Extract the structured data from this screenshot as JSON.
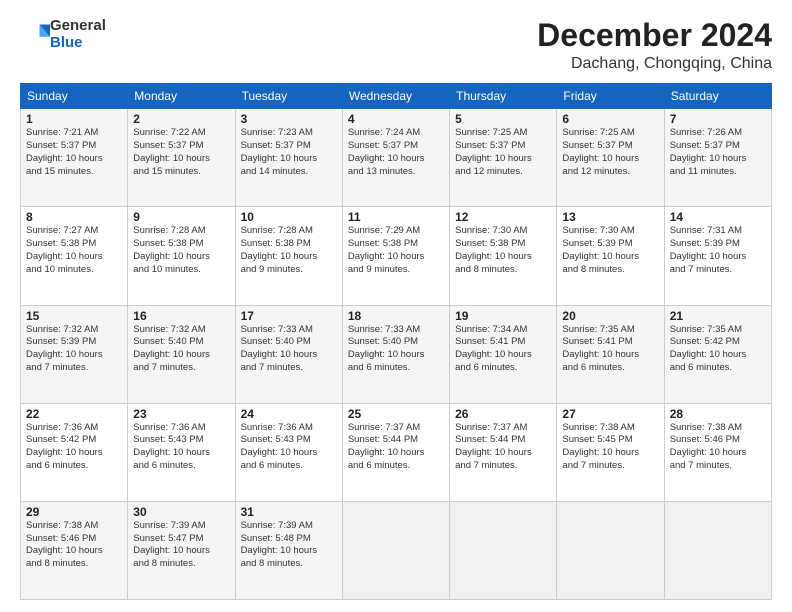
{
  "header": {
    "logo_line1": "General",
    "logo_line2": "Blue",
    "month": "December 2024",
    "location": "Dachang, Chongqing, China"
  },
  "weekdays": [
    "Sunday",
    "Monday",
    "Tuesday",
    "Wednesday",
    "Thursday",
    "Friday",
    "Saturday"
  ],
  "weeks": [
    [
      {
        "day": "1",
        "info": "Sunrise: 7:21 AM\nSunset: 5:37 PM\nDaylight: 10 hours\nand 15 minutes."
      },
      {
        "day": "2",
        "info": "Sunrise: 7:22 AM\nSunset: 5:37 PM\nDaylight: 10 hours\nand 15 minutes."
      },
      {
        "day": "3",
        "info": "Sunrise: 7:23 AM\nSunset: 5:37 PM\nDaylight: 10 hours\nand 14 minutes."
      },
      {
        "day": "4",
        "info": "Sunrise: 7:24 AM\nSunset: 5:37 PM\nDaylight: 10 hours\nand 13 minutes."
      },
      {
        "day": "5",
        "info": "Sunrise: 7:25 AM\nSunset: 5:37 PM\nDaylight: 10 hours\nand 12 minutes."
      },
      {
        "day": "6",
        "info": "Sunrise: 7:25 AM\nSunset: 5:37 PM\nDaylight: 10 hours\nand 12 minutes."
      },
      {
        "day": "7",
        "info": "Sunrise: 7:26 AM\nSunset: 5:37 PM\nDaylight: 10 hours\nand 11 minutes."
      }
    ],
    [
      {
        "day": "8",
        "info": "Sunrise: 7:27 AM\nSunset: 5:38 PM\nDaylight: 10 hours\nand 10 minutes."
      },
      {
        "day": "9",
        "info": "Sunrise: 7:28 AM\nSunset: 5:38 PM\nDaylight: 10 hours\nand 10 minutes."
      },
      {
        "day": "10",
        "info": "Sunrise: 7:28 AM\nSunset: 5:38 PM\nDaylight: 10 hours\nand 9 minutes."
      },
      {
        "day": "11",
        "info": "Sunrise: 7:29 AM\nSunset: 5:38 PM\nDaylight: 10 hours\nand 9 minutes."
      },
      {
        "day": "12",
        "info": "Sunrise: 7:30 AM\nSunset: 5:38 PM\nDaylight: 10 hours\nand 8 minutes."
      },
      {
        "day": "13",
        "info": "Sunrise: 7:30 AM\nSunset: 5:39 PM\nDaylight: 10 hours\nand 8 minutes."
      },
      {
        "day": "14",
        "info": "Sunrise: 7:31 AM\nSunset: 5:39 PM\nDaylight: 10 hours\nand 7 minutes."
      }
    ],
    [
      {
        "day": "15",
        "info": "Sunrise: 7:32 AM\nSunset: 5:39 PM\nDaylight: 10 hours\nand 7 minutes."
      },
      {
        "day": "16",
        "info": "Sunrise: 7:32 AM\nSunset: 5:40 PM\nDaylight: 10 hours\nand 7 minutes."
      },
      {
        "day": "17",
        "info": "Sunrise: 7:33 AM\nSunset: 5:40 PM\nDaylight: 10 hours\nand 7 minutes."
      },
      {
        "day": "18",
        "info": "Sunrise: 7:33 AM\nSunset: 5:40 PM\nDaylight: 10 hours\nand 6 minutes."
      },
      {
        "day": "19",
        "info": "Sunrise: 7:34 AM\nSunset: 5:41 PM\nDaylight: 10 hours\nand 6 minutes."
      },
      {
        "day": "20",
        "info": "Sunrise: 7:35 AM\nSunset: 5:41 PM\nDaylight: 10 hours\nand 6 minutes."
      },
      {
        "day": "21",
        "info": "Sunrise: 7:35 AM\nSunset: 5:42 PM\nDaylight: 10 hours\nand 6 minutes."
      }
    ],
    [
      {
        "day": "22",
        "info": "Sunrise: 7:36 AM\nSunset: 5:42 PM\nDaylight: 10 hours\nand 6 minutes."
      },
      {
        "day": "23",
        "info": "Sunrise: 7:36 AM\nSunset: 5:43 PM\nDaylight: 10 hours\nand 6 minutes."
      },
      {
        "day": "24",
        "info": "Sunrise: 7:36 AM\nSunset: 5:43 PM\nDaylight: 10 hours\nand 6 minutes."
      },
      {
        "day": "25",
        "info": "Sunrise: 7:37 AM\nSunset: 5:44 PM\nDaylight: 10 hours\nand 6 minutes."
      },
      {
        "day": "26",
        "info": "Sunrise: 7:37 AM\nSunset: 5:44 PM\nDaylight: 10 hours\nand 7 minutes."
      },
      {
        "day": "27",
        "info": "Sunrise: 7:38 AM\nSunset: 5:45 PM\nDaylight: 10 hours\nand 7 minutes."
      },
      {
        "day": "28",
        "info": "Sunrise: 7:38 AM\nSunset: 5:46 PM\nDaylight: 10 hours\nand 7 minutes."
      }
    ],
    [
      {
        "day": "29",
        "info": "Sunrise: 7:38 AM\nSunset: 5:46 PM\nDaylight: 10 hours\nand 8 minutes."
      },
      {
        "day": "30",
        "info": "Sunrise: 7:39 AM\nSunset: 5:47 PM\nDaylight: 10 hours\nand 8 minutes."
      },
      {
        "day": "31",
        "info": "Sunrise: 7:39 AM\nSunset: 5:48 PM\nDaylight: 10 hours\nand 8 minutes."
      },
      {
        "day": "",
        "info": ""
      },
      {
        "day": "",
        "info": ""
      },
      {
        "day": "",
        "info": ""
      },
      {
        "day": "",
        "info": ""
      }
    ]
  ]
}
